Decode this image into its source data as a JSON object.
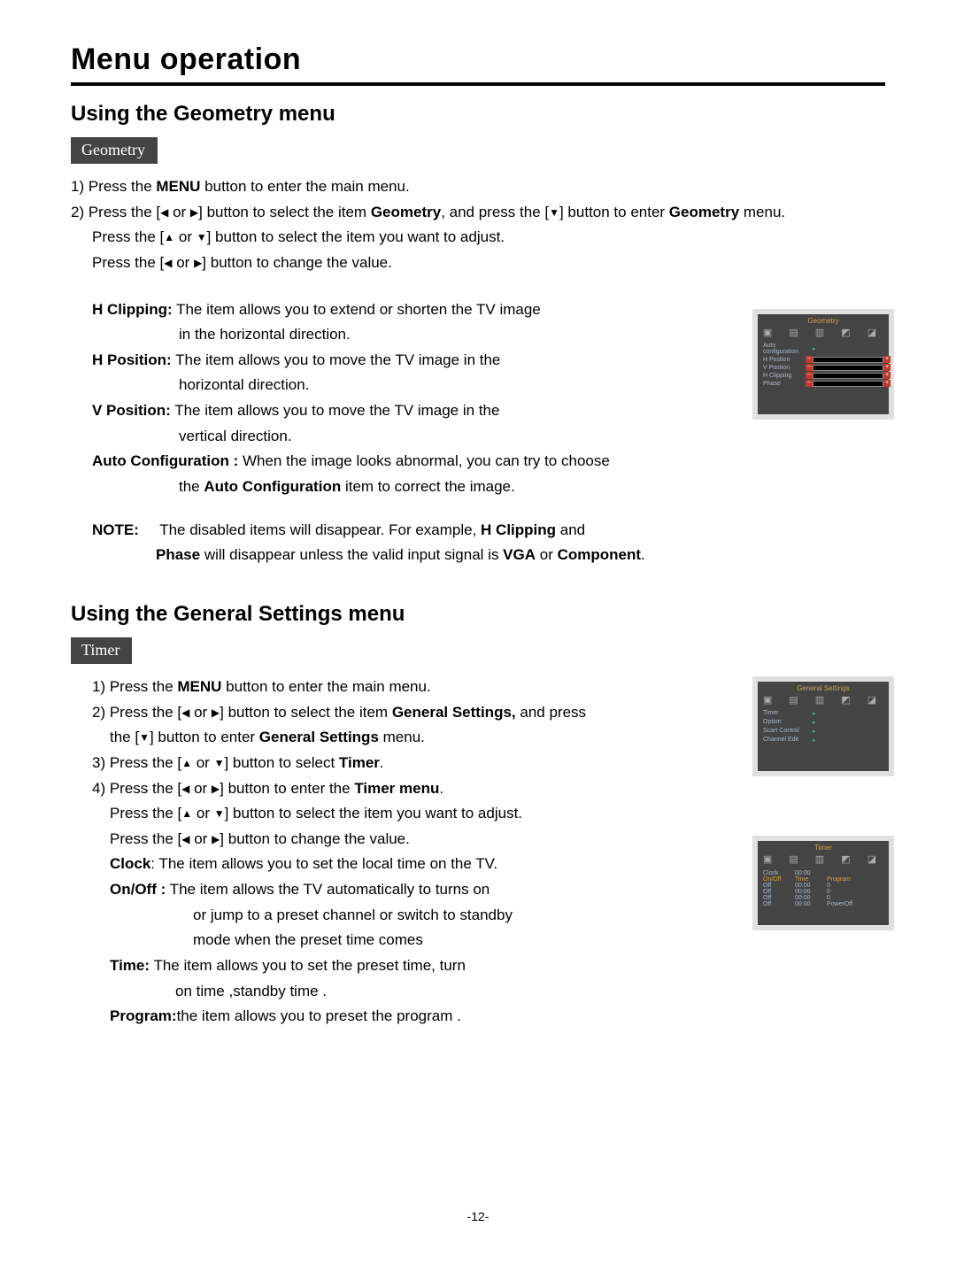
{
  "page": {
    "title": "Menu operation",
    "pagenum": "-12-"
  },
  "section1": {
    "heading": "Using the Geometry  menu",
    "tag": "Geometry",
    "step1_a": "1) Press the ",
    "step1_b": "MENU",
    "step1_c": " button to enter the main menu.",
    "step2_a": "2) Press the [",
    "step2_b": " or ",
    "step2_c": "] button to select the item ",
    "step2_d": "Geometry",
    "step2_e": ", and press the  [",
    "step2_f": "]  button to enter ",
    "step2_g": "Geometry",
    "step2_h": " menu.",
    "step2_i": "Press the [",
    "step2_j": " or ",
    "step2_k": "] button to select the item you want to adjust.",
    "step2_l": "Press the [",
    "step2_m": " or ",
    "step2_n": "] button to change the value.",
    "hclip_lbl": "H Clipping:",
    "hclip_txt1": " The item allows you to extend or shorten the TV image",
    "hclip_txt2": "in the horizontal direction.",
    "hpos_lbl": "H Position:",
    "hpos_txt1": " The item allows you to move the TV image in the",
    "hpos_txt2": "horizontal direction.",
    "vpos_lbl": "V Position:",
    "vpos_txt1": " The item allows you to move the TV image in the",
    "vpos_txt2": "vertical direction.",
    "auto_lbl": "Auto Configuration :",
    "auto_txt1": " When the image looks abnormal, you can try to choose",
    "auto_txt2a": "the ",
    "auto_txt2b": "Auto Configuration",
    "auto_txt2c": " item to correct the image.",
    "note_lbl": "NOTE:",
    "note_txt1a": "The disabled items will disappear. For example,  ",
    "note_txt1b": "H Clipping",
    "note_txt1c": " and",
    "note_txt2a": "Phase",
    "note_txt2b": "  will disappear unless the valid input signal is ",
    "note_txt2c": "VGA",
    "note_txt2d": " or ",
    "note_txt2e": "Component",
    "note_txt2f": "."
  },
  "section2": {
    "heading": "Using the General Settings  menu",
    "tag": "Timer",
    "s1_a": "1) Press the ",
    "s1_b": "MENU",
    "s1_c": " button to enter the main menu.",
    "s2_a": "2) Press the [",
    "s2_b": " or ",
    "s2_c": "] button to select the item ",
    "s2_d": "General Settings,",
    "s2_e": " and press",
    "s2_f": "the [",
    "s2_g": "] button to enter ",
    "s2_h": "General Settings",
    "s2_i": " menu.",
    "s3_a": "3) Press the [",
    "s3_b": " or ",
    "s3_c": "] button to select ",
    "s3_d": "Timer",
    "s3_e": ".",
    "s4_a": "4) Press the [",
    "s4_b": " or ",
    "s4_c": "] button to enter the ",
    "s4_d": "Timer menu",
    "s4_e": ".",
    "s4_f": "Press the  [",
    "s4_g": " or ",
    "s4_h": "] button to select the item you want to adjust.",
    "s4_i": "Press the  [",
    "s4_j": " or ",
    "s4_k": "] button to change the value.",
    "clock_lbl": "Clock",
    "clock_txt": ": The item allows you to set the local time on the TV.",
    "onoff_lbl": "On/Off :",
    "onoff_txt1": " The item allows the TV automatically to turns on",
    "onoff_txt2": "or jump to a preset channel or switch  to standby",
    "onoff_txt3": "mode when the preset time comes",
    "time_lbl": "Time:",
    "time_txt1": " The item allows you to set  the preset  time, turn",
    "time_txt2": "on time ,standby time .",
    "prog_lbl": "Program:",
    "prog_txt": "the item allows you to preset the program ."
  },
  "osd_geometry": {
    "title": "Geometry",
    "rows": [
      "Auto configuration",
      "H Postion",
      "V Postion",
      "H Clipping",
      "Phase"
    ]
  },
  "osd_general": {
    "title": "General Settings",
    "rows": [
      "Timer",
      "Option",
      "Scart Control",
      "Channel Edit"
    ]
  },
  "osd_timer": {
    "title": "Timer",
    "header": [
      "On/Off",
      "Time",
      "Program"
    ],
    "clock_lbl": "Clock",
    "clock_val": "00:00",
    "rows": [
      {
        "c1": "Off",
        "c2": "00:00",
        "c3": "0"
      },
      {
        "c1": "Off",
        "c2": "00:00",
        "c3": "0"
      },
      {
        "c1": "Off",
        "c2": "00:00",
        "c3": "0"
      },
      {
        "c1": "Off",
        "c2": "00:00",
        "c3": "PowerOff"
      }
    ]
  }
}
